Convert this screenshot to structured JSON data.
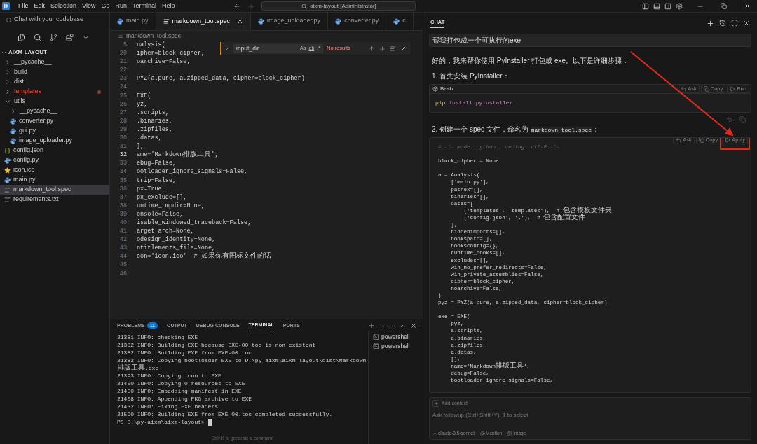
{
  "title_bar": {
    "menu": [
      "File",
      "Edit",
      "Selection",
      "View",
      "Go",
      "Run",
      "Terminal",
      "Help"
    ],
    "search": {
      "value": "aixm-layout [Administrator]"
    }
  },
  "sidebar": {
    "chat_link": "Chat with your codebase",
    "section": "AIXM-LAYOUT",
    "tree": [
      {
        "label": "__pycache__",
        "kind": "folder",
        "expanded": false,
        "problem": false
      },
      {
        "label": "build",
        "kind": "folder",
        "expanded": false,
        "problem": false
      },
      {
        "label": "dist",
        "kind": "folder",
        "expanded": false,
        "problem": false
      },
      {
        "label": "templates",
        "kind": "folder",
        "expanded": false,
        "problem": true
      },
      {
        "label": "utils",
        "kind": "folder",
        "expanded": true,
        "problem": false,
        "children": [
          {
            "label": "__pycache__",
            "kind": "folder",
            "expanded": false,
            "problem": false
          },
          {
            "label": "converter.py",
            "kind": "python",
            "problem": false
          },
          {
            "label": "gui.py",
            "kind": "python",
            "problem": false
          },
          {
            "label": "image_uploader.py",
            "kind": "python",
            "problem": false
          }
        ]
      },
      {
        "label": "config.json",
        "kind": "json",
        "problem": false
      },
      {
        "label": "config.py",
        "kind": "python",
        "problem": false
      },
      {
        "label": "icon.ico",
        "kind": "image",
        "problem": false
      },
      {
        "label": "main.py",
        "kind": "python",
        "problem": false
      },
      {
        "label": "markdown_tool.spec",
        "kind": "spec",
        "problem": false,
        "selected": true
      },
      {
        "label": "requirements.txt",
        "kind": "text",
        "problem": false
      }
    ]
  },
  "editor": {
    "tabs": [
      {
        "label": "main.py",
        "kind": "python",
        "selected": false
      },
      {
        "label": "markdown_tool.spec",
        "kind": "spec",
        "selected": true
      },
      {
        "label": "image_uploader.py",
        "kind": "python",
        "selected": false
      },
      {
        "label": "converter.py",
        "kind": "python",
        "selected": false
      },
      {
        "label": "c",
        "kind": "python",
        "selected": false
      }
    ],
    "breadcrumb": "markdown_tool.spec",
    "lines": [
      {
        "number": "5",
        "text": "nalysis(",
        "current": false
      },
      {
        "number": "20",
        "text": "ipher=block_cipher,",
        "current": false
      },
      {
        "number": "21",
        "text": "oarchive=False,",
        "current": false
      },
      {
        "number": "22",
        "current": false
      },
      {
        "number": "23",
        "text": "PYZ(a.pure, a.zipped_data, cipher=block_cipher)",
        "current": false
      },
      {
        "number": "24",
        "current": false
      },
      {
        "number": "25",
        "text": "EXE(",
        "current": false
      },
      {
        "number": "26",
        "text": "yz,",
        "current": false
      },
      {
        "number": "27",
        "text": ".scripts,",
        "current": false
      },
      {
        "number": "28",
        "text": ".binaries,",
        "current": false
      },
      {
        "number": "29",
        "text": ".zipfiles,",
        "current": false
      },
      {
        "number": "30",
        "text": ".datas,",
        "current": false
      },
      {
        "number": "31",
        "text": "],",
        "current": false
      },
      {
        "number": "32",
        "text": "ame='Markdown排版工具',",
        "current": true
      },
      {
        "number": "33",
        "text": "ebug=False,",
        "current": false
      },
      {
        "number": "34",
        "text": "ootloader_ignore_signals=False,",
        "current": false
      },
      {
        "number": "35",
        "text": "trip=False,",
        "current": false
      },
      {
        "number": "36",
        "text": "px=True,",
        "current": false
      },
      {
        "number": "37",
        "text": "px_exclude=[],",
        "current": false
      },
      {
        "number": "38",
        "text": "untime_tmpdir=None,",
        "current": false
      },
      {
        "number": "39",
        "text": "onsole=False,",
        "current": false
      },
      {
        "number": "40",
        "text": "isable_windowed_traceback=False,",
        "current": false
      },
      {
        "number": "41",
        "text": "arget_arch=None,",
        "current": false
      },
      {
        "number": "42",
        "text": "odesign_identity=None,",
        "current": false
      },
      {
        "number": "43",
        "text": "ntitlements_file=None,",
        "current": false
      },
      {
        "number": "44",
        "text": "con='icon.ico'  # 如果你有图标文件的话",
        "current": false
      },
      {
        "number": "45",
        "current": false
      },
      {
        "number": "46",
        "current": false
      }
    ],
    "find": {
      "value": "input_dir",
      "options": [
        "Aa",
        "ab",
        ".*"
      ],
      "status": "No results"
    }
  },
  "panel": {
    "tabs": [
      {
        "label": "PROBLEMS",
        "badge": "11",
        "selected": false
      },
      {
        "label": "OUTPUT",
        "selected": false
      },
      {
        "label": "DEBUG CONSOLE",
        "selected": false
      },
      {
        "label": "TERMINAL",
        "selected": true
      },
      {
        "label": "PORTS",
        "selected": false
      }
    ],
    "terminal_lines": [
      "21381 INFO: checking EXE",
      "21382 INFO: Building EXE because EXE-00.toc is non existent",
      "21382 INFO: Building EXE from EXE-00.toc",
      "21383 INFO: Copying bootloader EXE to D:\\py-aixm\\aixm-layout\\dist\\Markdown",
      "排版工具.exe",
      "21393 INFO: Copying icon to EXE",
      "21400 INFO: Copying 0 resources to EXE",
      "21400 INFO: Embedding manifest in EXE",
      "21408 INFO: Appending PKG archive to EXE",
      "21432 INFO: Fixing EXE headers",
      "21590 INFO: Building EXE from EXE-00.toc completed successfully."
    ],
    "prompt": "PS D:\\py-aixm\\aixm-layout>",
    "hint": "Ctrl+K to generate a command",
    "terminals": [
      {
        "label": "powershell",
        "selected": false
      },
      {
        "label": "powershell",
        "selected": false
      }
    ]
  },
  "chat": {
    "tab": "CHAT",
    "user_message": "帮我打包成一个可执行的exe",
    "intro": "好的，我来帮你使用 PyInstaller 打包成 exe。以下是详细步骤：",
    "step1": "1. 首先安装 PyInstaller：",
    "bash_block": {
      "language": "Bash",
      "actions": [
        {
          "label": "Ask",
          "kind": "ask"
        },
        {
          "label": "Copy",
          "kind": "copy"
        },
        {
          "label": "Run",
          "kind": "run"
        }
      ],
      "code": [
        {
          "text": "pip",
          "kind": "command"
        },
        {
          "text": "install pyinstaller",
          "kind": "argument"
        }
      ]
    },
    "step2": {
      "before": "2. 创建一个 spec 文件，命名为 ",
      "code": "markdown_tool.spec",
      "after": "："
    },
    "spec_block": {
      "actions": [
        {
          "label": "Ask",
          "kind": "ask"
        },
        {
          "label": "Copy",
          "kind": "copy"
        },
        {
          "label": "Apply",
          "kind": "run"
        }
      ],
      "lines": [
        {
          "kind": "comment",
          "text": "# -*- mode: python ; coding: utf-8 -*-"
        },
        {
          "kind": "blank"
        },
        {
          "kind": "code",
          "text": "block_cipher = None"
        },
        {
          "kind": "blank"
        },
        {
          "kind": "code",
          "text": "a = Analysis("
        },
        {
          "kind": "code",
          "text": "    ['main.py'],"
        },
        {
          "kind": "code",
          "text": "    pathex=[],"
        },
        {
          "kind": "code",
          "text": "    binaries=[],"
        },
        {
          "kind": "code",
          "text": "    datas=["
        },
        {
          "kind": "code",
          "text": "        ('templates', 'templates'),  # 包含模板文件夹"
        },
        {
          "kind": "code",
          "text": "        ('config.json', '.'),  # 包含配置文件"
        },
        {
          "kind": "code",
          "text": "    ],"
        },
        {
          "kind": "code",
          "text": "    hiddenimports=[],"
        },
        {
          "kind": "code",
          "text": "    hookspath=[],"
        },
        {
          "kind": "code",
          "text": "    hooksconfig={},"
        },
        {
          "kind": "code",
          "text": "    runtime_hooks=[],"
        },
        {
          "kind": "code",
          "text": "    excludes=[],"
        },
        {
          "kind": "code",
          "text": "    win_no_prefer_redirects=False,"
        },
        {
          "kind": "code",
          "text": "    win_private_assemblies=False,"
        },
        {
          "kind": "code",
          "text": "    cipher=block_cipher,"
        },
        {
          "kind": "code",
          "text": "    noarchive=False,"
        },
        {
          "kind": "code",
          "text": ")"
        },
        {
          "kind": "code",
          "text": "pyz = PYZ(a.pure, a.zipped_data, cipher=block_cipher)"
        },
        {
          "kind": "blank"
        },
        {
          "kind": "code",
          "text": "exe = EXE("
        },
        {
          "kind": "code",
          "text": "    pyz,"
        },
        {
          "kind": "code",
          "text": "    a.scripts,"
        },
        {
          "kind": "code",
          "text": "    a.binaries,"
        },
        {
          "kind": "code",
          "text": "    a.zipfiles,"
        },
        {
          "kind": "code",
          "text": "    a.datas,"
        },
        {
          "kind": "code",
          "text": "    [],"
        },
        {
          "kind": "code",
          "text": "    name='Markdown排版工具',"
        },
        {
          "kind": "code",
          "text": "    debug=False,"
        },
        {
          "kind": "code",
          "text": "    bootloader_ignore_signals=False,"
        }
      ]
    },
    "input": {
      "context_button": "Add context",
      "placeholder": "Ask followup (Ctrl+Shift+Y), 1 to select",
      "model": "claude-3.5-sonnet",
      "mention": "Mention",
      "image": "Image"
    }
  }
}
